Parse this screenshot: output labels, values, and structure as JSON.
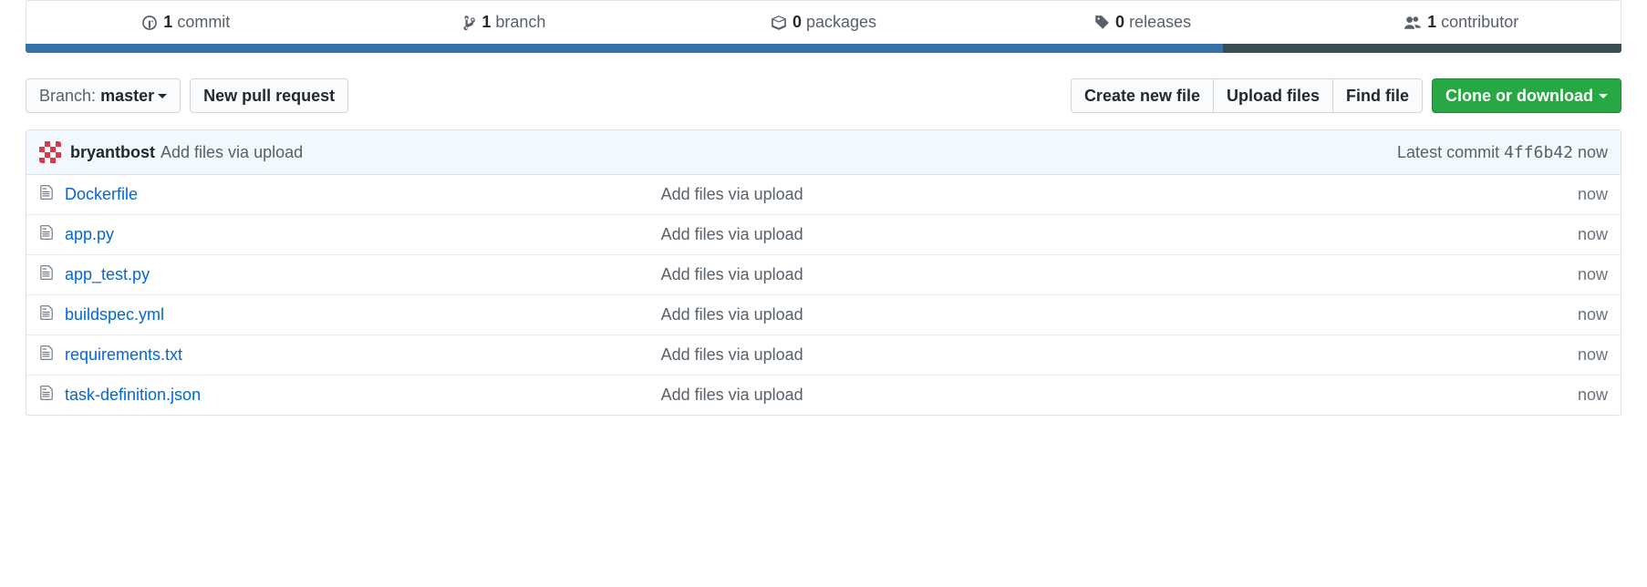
{
  "stats": {
    "commits": {
      "count": "1",
      "label": "commit"
    },
    "branches": {
      "count": "1",
      "label": "branch"
    },
    "packages": {
      "count": "0",
      "label": "packages"
    },
    "releases": {
      "count": "0",
      "label": "releases"
    },
    "contributors": {
      "count": "1",
      "label": "contributor"
    }
  },
  "lang_bar": {
    "a_pct": "75%",
    "b_pct": "25%"
  },
  "toolbar": {
    "branch_prefix": "Branch:",
    "branch_name": "master",
    "new_pr": "New pull request",
    "create_file": "Create new file",
    "upload_files": "Upload files",
    "find_file": "Find file",
    "clone": "Clone or download"
  },
  "tease": {
    "author": "bryantbost",
    "message": "Add files via upload",
    "latest_label": "Latest commit",
    "sha": "4ff6b42",
    "when": "now"
  },
  "files": [
    {
      "name": "Dockerfile",
      "msg": "Add files via upload",
      "age": "now"
    },
    {
      "name": "app.py",
      "msg": "Add files via upload",
      "age": "now"
    },
    {
      "name": "app_test.py",
      "msg": "Add files via upload",
      "age": "now"
    },
    {
      "name": "buildspec.yml",
      "msg": "Add files via upload",
      "age": "now"
    },
    {
      "name": "requirements.txt",
      "msg": "Add files via upload",
      "age": "now"
    },
    {
      "name": "task-definition.json",
      "msg": "Add files via upload",
      "age": "now"
    }
  ]
}
